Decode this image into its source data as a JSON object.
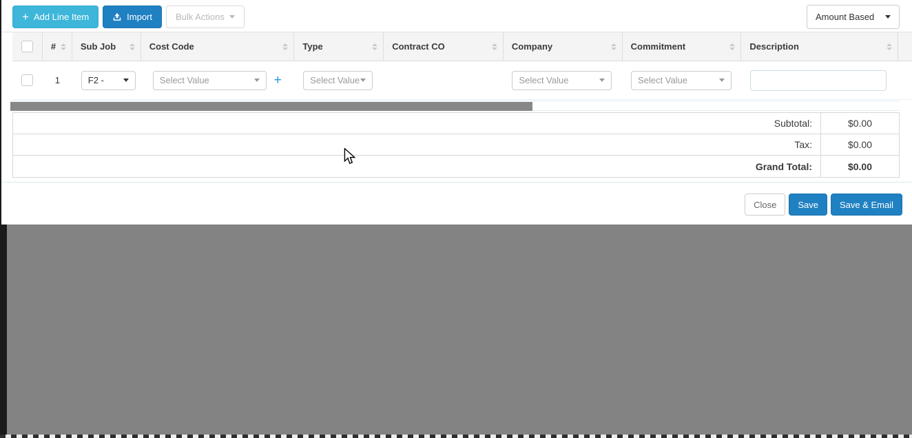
{
  "toolbar": {
    "add_line_item_plus": "+",
    "add_line_item_label": "Add Line Item",
    "import_label": "Import",
    "bulk_actions_label": "Bulk Actions",
    "view_mode_value": "Amount Based"
  },
  "table": {
    "headers": {
      "number": "#",
      "sub_job": "Sub Job",
      "cost_code": "Cost Code",
      "type": "Type",
      "contract_co": "Contract CO",
      "company": "Company",
      "commitment": "Commitment",
      "description": "Description"
    },
    "rows": [
      {
        "number": "1",
        "sub_job_value": "F2 -",
        "cost_code_placeholder": "Select Value",
        "type_placeholder": "Select Value",
        "contract_co_value": "",
        "company_placeholder": "Select Value",
        "commitment_placeholder": "Select Value",
        "description_value": ""
      }
    ],
    "add_cost_code_label": "+"
  },
  "summary": {
    "subtotal_label": "Subtotal:",
    "subtotal_value": "$0.00",
    "tax_label": "Tax:",
    "tax_value": "$0.00",
    "grand_total_label": "Grand Total:",
    "grand_total_value": "$0.00"
  },
  "footer": {
    "close_label": "Close",
    "save_label": "Save",
    "save_email_label": "Save & Email"
  },
  "colors": {
    "add_line_item_bg": "#3db6da",
    "import_bg": "#1f80c2",
    "save_bg": "#1f80c2",
    "header_bg": "#f4f4f4",
    "scrollbar_thumb": "#878787",
    "overlay_gray": "#838383",
    "overlay_left_strip": "#1a1a1a"
  }
}
